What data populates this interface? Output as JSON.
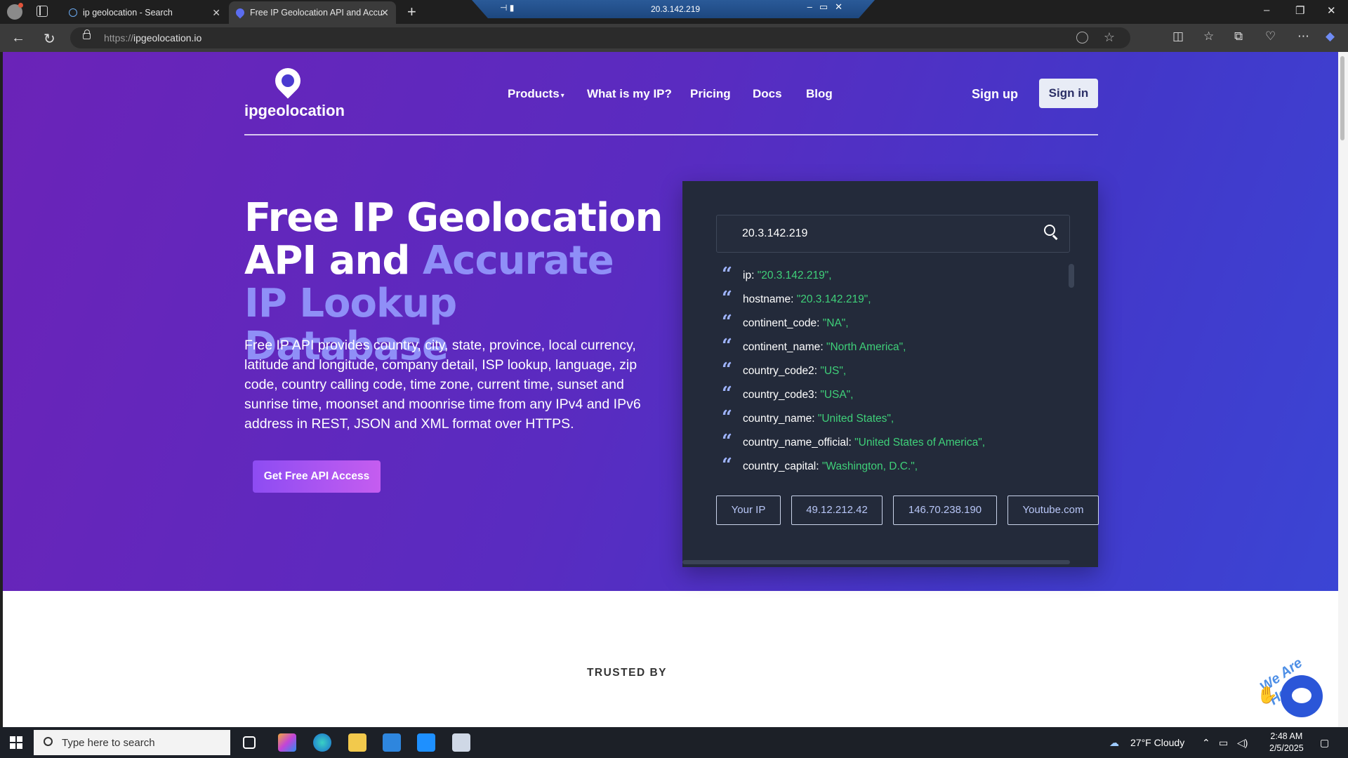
{
  "browser": {
    "tabs": [
      {
        "title": "ip geolocation - Search"
      },
      {
        "title": "Free IP Geolocation API and Accu"
      }
    ],
    "remote_session_title": "20.3.142.219",
    "url_prefix": "https://",
    "url_host": "ipgeolocation.io"
  },
  "site": {
    "logo_text": "ipgeolocation",
    "nav": {
      "products": "Products",
      "what_is_my_ip": "What is my IP?",
      "pricing": "Pricing",
      "docs": "Docs",
      "blog": "Blog"
    },
    "sign_up": "Sign up",
    "sign_in": "Sign in"
  },
  "hero": {
    "heading_part1": "Free IP Geolocation API and ",
    "heading_accent": "Accurate IP Lookup Database",
    "description": "Free IP API provides country, city, state, province, local currency, latitude and longitude, company detail, ISP lookup, language, zip code, country calling code, time zone, current time, sunset and sunrise time, moonset and moonrise time from any IPv4 and IPv6 address in REST, JSON and XML format over HTTPS.",
    "cta": "Get Free API Access"
  },
  "lookup": {
    "input_value": "20.3.142.219",
    "fields": [
      {
        "key": "ip",
        "value": "\"20.3.142.219\","
      },
      {
        "key": "hostname",
        "value": "\"20.3.142.219\","
      },
      {
        "key": "continent_code",
        "value": "\"NA\","
      },
      {
        "key": "continent_name",
        "value": "\"North America\","
      },
      {
        "key": "country_code2",
        "value": "\"US\","
      },
      {
        "key": "country_code3",
        "value": "\"USA\","
      },
      {
        "key": "country_name",
        "value": "\"United States\","
      },
      {
        "key": "country_name_official",
        "value": "\"United States of America\","
      },
      {
        "key": "country_capital",
        "value": "\"Washington, D.C.\","
      }
    ],
    "chips": [
      "Your IP",
      "49.12.212.42",
      "146.70.238.190",
      "Youtube.com"
    ]
  },
  "trusted_by": "TRUSTED BY",
  "chat_badge": "We Are Here!",
  "taskbar": {
    "search_placeholder": "Type here to search",
    "weather": "27°F  Cloudy",
    "time": "2:48 AM",
    "date": "2/5/2025"
  },
  "colors": {
    "hero_start": "#6b23b8",
    "hero_end": "#3b45d4",
    "accent_text": "#8f8ff7",
    "json_value": "#3fd079",
    "panel": "#232a3a"
  }
}
